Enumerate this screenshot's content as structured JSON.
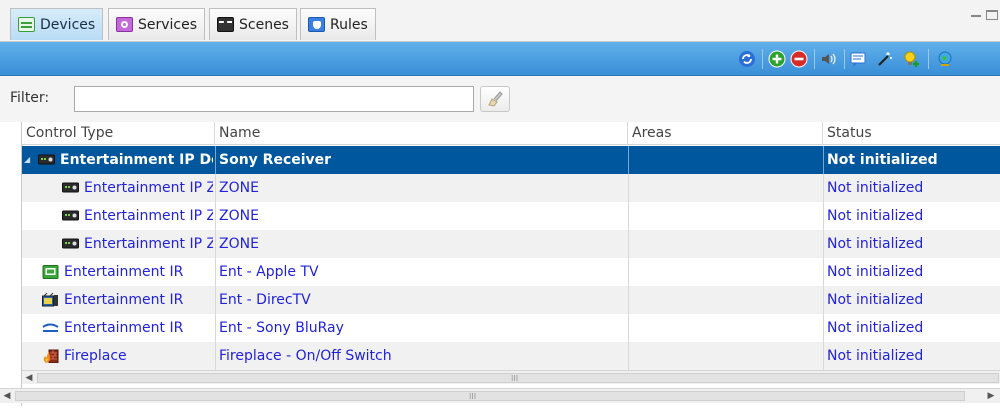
{
  "tabs": [
    {
      "label": "Devices",
      "icon": "devices-icon",
      "color": "#3a9e3a"
    },
    {
      "label": "Services",
      "icon": "services-icon",
      "color": "#a04ac0"
    },
    {
      "label": "Scenes",
      "icon": "scenes-icon",
      "color": "#222222"
    },
    {
      "label": "Rules",
      "icon": "rules-icon",
      "color": "#2d6fd1"
    }
  ],
  "toolbar": {
    "buttons": [
      "refresh-icon",
      "add-icon",
      "remove-icon",
      "sound-icon",
      "message-icon",
      "wand-icon",
      "lightbulb-add-icon",
      "globe-icon"
    ]
  },
  "filter": {
    "label": "Filter:",
    "value": "",
    "placeholder": ""
  },
  "grid": {
    "columns": [
      "Control Type",
      "Name",
      "Areas",
      "Status"
    ],
    "rows": [
      {
        "control_type": "Entertainment IP Device",
        "name": "Sony Receiver",
        "areas": "",
        "status": "Not initialized",
        "icon": "receiver-icon"
      },
      {
        "control_type": "Entertainment IP Zone",
        "name": "ZONE",
        "areas": "",
        "status": "Not initialized",
        "icon": "receiver-icon"
      },
      {
        "control_type": "Entertainment IP Zone",
        "name": "ZONE",
        "areas": "",
        "status": "Not initialized",
        "icon": "receiver-icon"
      },
      {
        "control_type": "Entertainment IP Zone",
        "name": "ZONE",
        "areas": "",
        "status": "Not initialized",
        "icon": "receiver-icon"
      },
      {
        "control_type": "Entertainment IR",
        "name": "Ent - Apple TV",
        "areas": "",
        "status": "Not initialized",
        "icon": "tv-icon"
      },
      {
        "control_type": "Entertainment IR",
        "name": "Ent - DirecTV",
        "areas": "",
        "status": "Not initialized",
        "icon": "satellite-icon"
      },
      {
        "control_type": "Entertainment IR",
        "name": "Ent - Sony BluRay",
        "areas": "",
        "status": "Not initialized",
        "icon": "bluray-icon"
      },
      {
        "control_type": "Fireplace",
        "name": "Fireplace - On/Off Switch",
        "areas": "",
        "status": "Not initialized",
        "icon": "fireplace-icon"
      }
    ]
  },
  "scrollbars": {
    "grip": "III"
  }
}
